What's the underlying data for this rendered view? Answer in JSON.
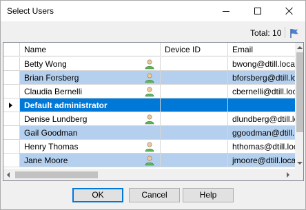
{
  "window": {
    "title": "Select Users"
  },
  "toolbar": {
    "total_label": "Total: 10"
  },
  "grid": {
    "columns": [
      "",
      "Name",
      "Device ID",
      "Email"
    ],
    "rows": [
      {
        "name": "Betty Wong",
        "device_id": "",
        "email": "bwong@dtill.local",
        "has_user_icon": true,
        "alt": false,
        "selected": false
      },
      {
        "name": "Brian Forsberg",
        "device_id": "",
        "email": "bforsberg@dtill.local",
        "has_user_icon": true,
        "alt": true,
        "selected": false
      },
      {
        "name": "Claudia Bernelli",
        "device_id": "",
        "email": "cbernelli@dtill.local",
        "has_user_icon": true,
        "alt": false,
        "selected": false
      },
      {
        "name": "Default administrator",
        "device_id": "",
        "email": "",
        "has_user_icon": false,
        "alt": false,
        "selected": true
      },
      {
        "name": "Denise Lundberg",
        "device_id": "",
        "email": "dlundberg@dtill.local",
        "has_user_icon": true,
        "alt": false,
        "selected": false
      },
      {
        "name": "Gail Goodman",
        "device_id": "",
        "email": "ggoodman@dtill.local",
        "has_user_icon": false,
        "alt": true,
        "selected": false
      },
      {
        "name": "Henry Thomas",
        "device_id": "",
        "email": "hthomas@dtill.local",
        "has_user_icon": true,
        "alt": false,
        "selected": false
      },
      {
        "name": "Jane Moore",
        "device_id": "",
        "email": "jmoore@dtill.local",
        "has_user_icon": true,
        "alt": true,
        "selected": false
      }
    ]
  },
  "buttons": {
    "ok": "OK",
    "cancel": "Cancel",
    "help": "Help"
  },
  "colors": {
    "selection": "#0078d7",
    "alt_row": "#b4d0ee",
    "user_icon_green": "#5cb85c"
  },
  "icons": {
    "flag": "flag-icon",
    "user": "user-icon",
    "current_row": "row-arrow-icon"
  }
}
